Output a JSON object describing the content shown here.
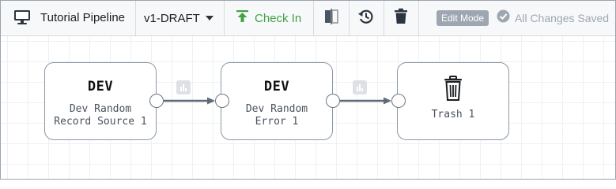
{
  "toolbar": {
    "pipeline_title": "Tutorial Pipeline",
    "version": "v1-DRAFT",
    "check_in_label": "Check In",
    "edit_mode_label": "Edit Mode",
    "save_status": "All Changes Saved"
  },
  "stages": [
    {
      "library": "DEV",
      "name": "Dev Random\nRecord Source 1"
    },
    {
      "library": "DEV",
      "name": "Dev Random\nError 1"
    },
    {
      "name": "Trash 1",
      "icon": "trash-icon"
    }
  ],
  "colors": {
    "check_in_green": "#43a047",
    "edit_badge_bg": "#9ea7b1",
    "stage_border": "#8b98a5",
    "link_line": "#5f6b78"
  }
}
